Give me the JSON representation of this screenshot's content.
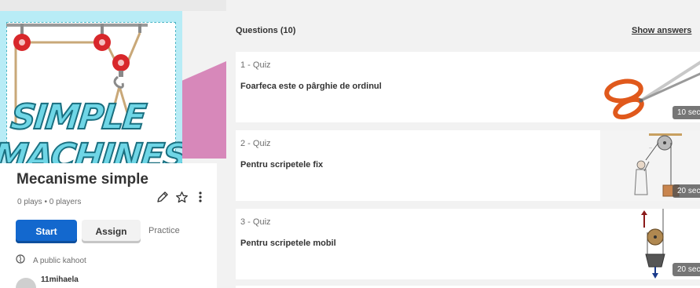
{
  "kahoot": {
    "title": "Mecanisme simple",
    "stats": "0 plays • 0 players",
    "visibility": "A public kahoot",
    "creator": "11mihaela",
    "cover_words": [
      "SIMPLE",
      "MACHINES"
    ],
    "icons": [
      "edit-icon",
      "star-icon",
      "more-icon",
      "globe-icon"
    ]
  },
  "actions": {
    "start": "Start",
    "assign": "Assign",
    "practice": "Practice"
  },
  "questions": {
    "header": "Questions (10)",
    "show_answers": "Show answers",
    "items": [
      {
        "type": "1 - Quiz",
        "text": "Foarfeca este o pârghie de ordinul",
        "time": "10 sec"
      },
      {
        "type": "2 - Quiz",
        "text": "Pentru scripetele fix",
        "time": "20 sec"
      },
      {
        "type": "3 - Quiz",
        "text": "Pentru scripetele mobil",
        "time": "20 sec"
      }
    ]
  },
  "colors": {
    "primary": "#1368ce",
    "cover_bg": "#b8ecf6",
    "accent_pink": "#d788ba",
    "pulley_red": "#d8272b"
  }
}
